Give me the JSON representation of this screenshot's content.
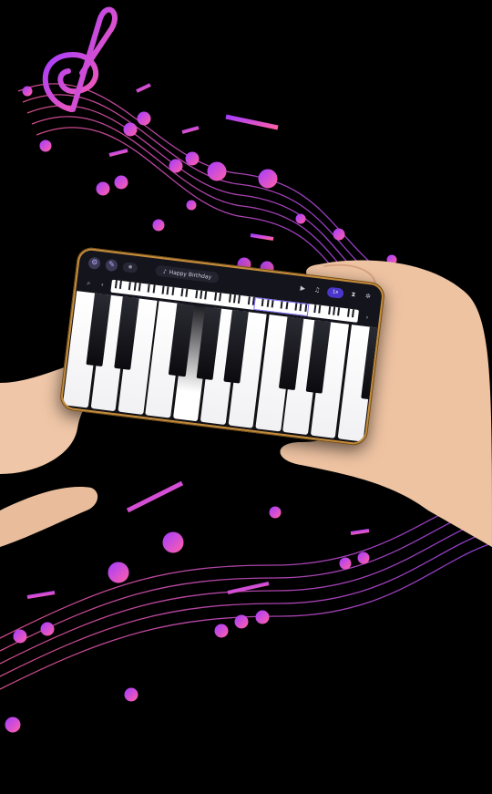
{
  "colors": {
    "background": "#000000",
    "note_purple": "#a63dff",
    "note_pink": "#ff5fa8",
    "phone_frame": "#c58b3a",
    "accent": "#4a36c9"
  },
  "app": {
    "top_left_icons": [
      "settings-icon",
      "edit-icon"
    ],
    "record_label": "",
    "song_icon": "music-note-icon",
    "song_title": "Happy Birthday",
    "play_icon": "play-icon",
    "note_icon": "music-note-icon",
    "speed_label": "1x",
    "right_icons": [
      "metronome-icon",
      "gear-icon"
    ],
    "search_icon": "zoom-icon",
    "nav_prev_icon": "chevron-left-icon",
    "nav_next_icon": "chevron-right-icon",
    "pressed_key_index": 4,
    "white_key_count": 11
  }
}
